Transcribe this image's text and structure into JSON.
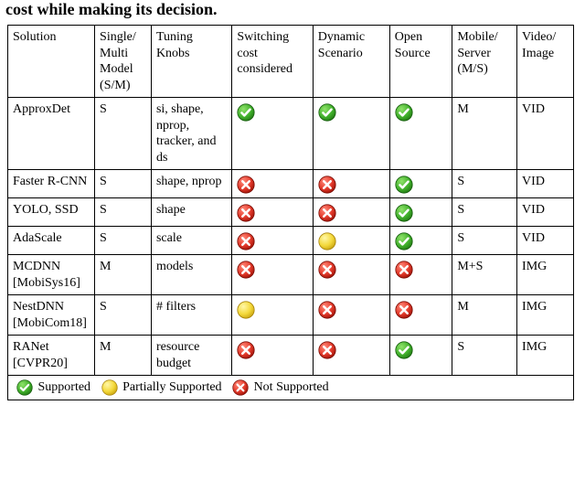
{
  "caption_fragment": "cost while making its decision.",
  "headers": {
    "solution": "Solution",
    "model": "Single/ Multi Model (S/M)",
    "knobs": "Tuning Knobs",
    "switching": "Switching cost considered",
    "dynamic": "Dynamic Scenario",
    "open": "Open Source",
    "mobile": "Mobile/ Server (M/S)",
    "media": "Video/ Image"
  },
  "rows": [
    {
      "solution": "ApproxDet",
      "model": "S",
      "knobs": "si, shape, nprop, tracker, and ds",
      "switching": "yes",
      "dynamic": "yes",
      "open": "yes",
      "mobile": "M",
      "media": "VID"
    },
    {
      "solution": "Faster R-CNN",
      "model": "S",
      "knobs": "shape, nprop",
      "switching": "no",
      "dynamic": "no",
      "open": "yes",
      "mobile": "S",
      "media": "VID"
    },
    {
      "solution": "YOLO, SSD",
      "model": "S",
      "knobs": "shape",
      "switching": "no",
      "dynamic": "no",
      "open": "yes",
      "mobile": "S",
      "media": "VID"
    },
    {
      "solution": "AdaScale",
      "model": "S",
      "knobs": "scale",
      "switching": "no",
      "dynamic": "partial",
      "open": "yes",
      "mobile": "S",
      "media": "VID"
    },
    {
      "solution": "MCDNN [MobiSys16]",
      "model": "M",
      "knobs": "models",
      "switching": "no",
      "dynamic": "no",
      "open": "no",
      "mobile": "M+S",
      "media": "IMG"
    },
    {
      "solution": "NestDNN [MobiCom18]",
      "model": "S",
      "knobs": "# filters",
      "switching": "partial",
      "dynamic": "no",
      "open": "no",
      "mobile": "M",
      "media": "IMG"
    },
    {
      "solution": "RANet [CVPR20]",
      "model": "M",
      "knobs": "resource budget",
      "switching": "no",
      "dynamic": "no",
      "open": "yes",
      "mobile": "S",
      "media": "IMG"
    }
  ],
  "legend": {
    "yes": "Supported",
    "partial": "Partially Supported",
    "no": "Not Supported"
  },
  "icons": {
    "yes": "check-icon",
    "partial": "partial-icon",
    "no": "cross-icon"
  },
  "chart_data": {
    "type": "table",
    "title": "Comparison of adaptive inference solutions",
    "columns": [
      "Solution",
      "Single/Multi Model (S/M)",
      "Tuning Knobs",
      "Switching cost considered",
      "Dynamic Scenario",
      "Open Source",
      "Mobile/Server (M/S)",
      "Video/Image"
    ],
    "rows": [
      [
        "ApproxDet",
        "S",
        "si, shape, nprop, tracker, and ds",
        "Supported",
        "Supported",
        "Supported",
        "M",
        "VID"
      ],
      [
        "Faster R-CNN",
        "S",
        "shape, nprop",
        "Not Supported",
        "Not Supported",
        "Supported",
        "S",
        "VID"
      ],
      [
        "YOLO, SSD",
        "S",
        "shape",
        "Not Supported",
        "Not Supported",
        "Supported",
        "S",
        "VID"
      ],
      [
        "AdaScale",
        "S",
        "scale",
        "Not Supported",
        "Partially Supported",
        "Supported",
        "S",
        "VID"
      ],
      [
        "MCDNN [MobiSys16]",
        "M",
        "models",
        "Not Supported",
        "Not Supported",
        "Not Supported",
        "M+S",
        "IMG"
      ],
      [
        "NestDNN [MobiCom18]",
        "S",
        "# filters",
        "Partially Supported",
        "Not Supported",
        "Not Supported",
        "M",
        "IMG"
      ],
      [
        "RANet [CVPR20]",
        "M",
        "resource budget",
        "Not Supported",
        "Not Supported",
        "Supported",
        "S",
        "IMG"
      ]
    ]
  }
}
